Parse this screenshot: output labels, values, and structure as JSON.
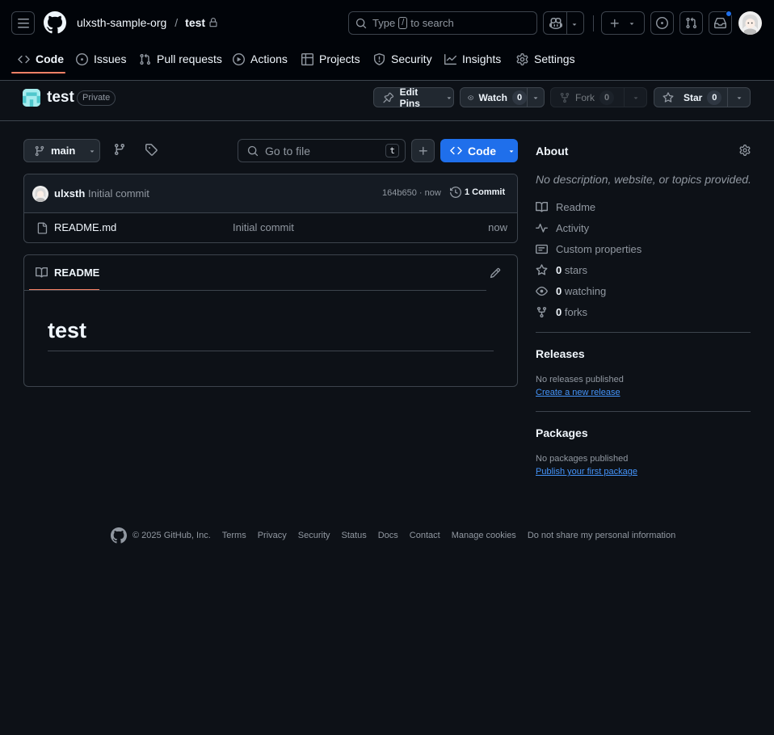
{
  "header": {
    "org": "ulxsth-sample-org",
    "slash": "/",
    "repo": "test",
    "search_placeholder": "Type / to search",
    "search_pre": "Type",
    "search_key": "/",
    "search_post": "to search"
  },
  "tabs": [
    {
      "label": "Code",
      "icon": "code-icon"
    },
    {
      "label": "Issues",
      "icon": "issue-icon"
    },
    {
      "label": "Pull requests",
      "icon": "pull-request-icon"
    },
    {
      "label": "Actions",
      "icon": "play-icon"
    },
    {
      "label": "Projects",
      "icon": "table-icon"
    },
    {
      "label": "Security",
      "icon": "shield-icon"
    },
    {
      "label": "Insights",
      "icon": "graph-icon"
    },
    {
      "label": "Settings",
      "icon": "gear-icon"
    }
  ],
  "repo_header": {
    "name": "test",
    "visibility": "Private",
    "edit_pins": "Edit Pins",
    "watch": "Watch",
    "watch_count": "0",
    "fork": "Fork",
    "fork_count": "0",
    "star": "Star",
    "star_count": "0"
  },
  "toolbar": {
    "branch": "main",
    "go_to_file": "Go to file",
    "shortcut": "t",
    "code_button": "Code"
  },
  "commit_bar": {
    "author": "ulxsth",
    "message": "Initial commit",
    "sha_time": "164b650 · now",
    "commit_count": "1 Commit"
  },
  "files": [
    {
      "name": "README.md",
      "message": "Initial commit",
      "time": "now"
    }
  ],
  "readme": {
    "tab_label": "README",
    "heading": "test"
  },
  "about": {
    "title": "About",
    "description": "No description, website, or topics provided.",
    "links": [
      {
        "label": "Readme",
        "icon": "book-icon"
      },
      {
        "label": "Activity",
        "icon": "pulse-icon"
      },
      {
        "label": "Custom properties",
        "icon": "note-icon"
      }
    ],
    "stats": [
      {
        "count": "0",
        "label": "stars",
        "icon": "star-icon"
      },
      {
        "count": "0",
        "label": "watching",
        "icon": "eye-icon"
      },
      {
        "count": "0",
        "label": "forks",
        "icon": "fork-icon"
      }
    ]
  },
  "releases": {
    "title": "Releases",
    "empty": "No releases published",
    "link": "Create a new release"
  },
  "packages": {
    "title": "Packages",
    "empty": "No packages published",
    "link": "Publish your first package"
  },
  "footer": {
    "copyright": "© 2025 GitHub, Inc.",
    "links": [
      "Terms",
      "Privacy",
      "Security",
      "Status",
      "Docs",
      "Contact",
      "Manage cookies",
      "Do not share my personal information"
    ]
  },
  "colors": {
    "background": "#0d1117",
    "header_bg": "#010409",
    "border": "#3d444d",
    "accent_blue": "#1f6feb",
    "link": "#4493f8",
    "tab_underline": "#f78166",
    "muted": "#9198a1"
  }
}
